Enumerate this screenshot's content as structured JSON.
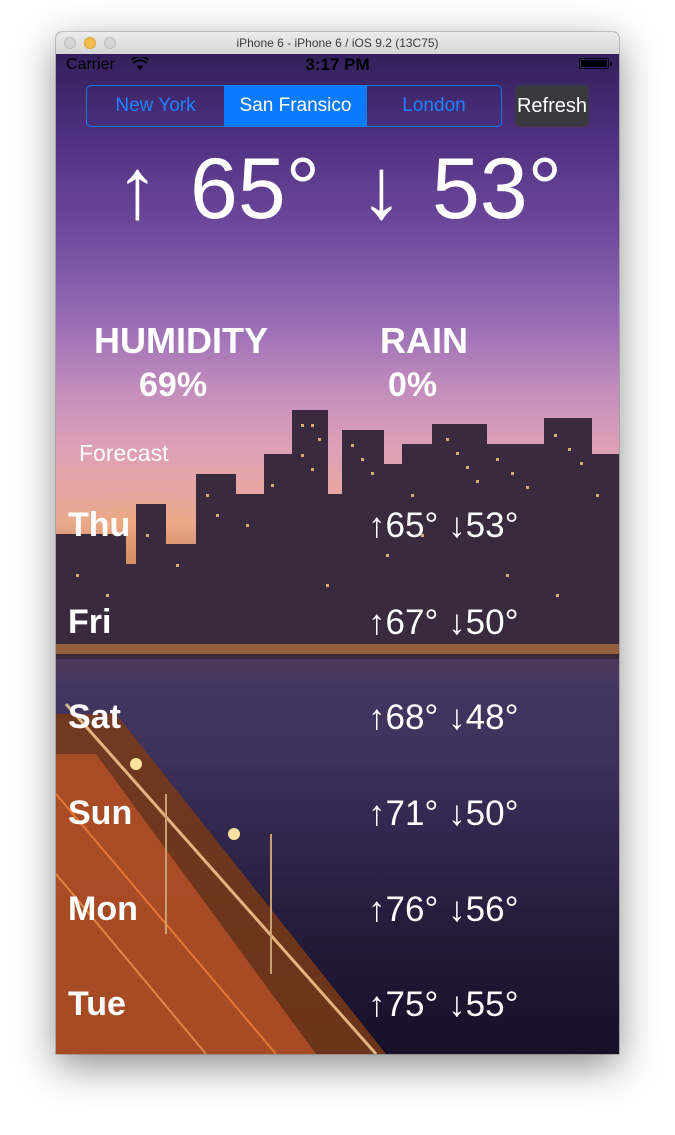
{
  "window": {
    "title": "iPhone 6 - iPhone 6 / iOS 9.2 (13C75)"
  },
  "status_bar": {
    "carrier": "Carrier",
    "time": "3:17 PM"
  },
  "city_selector": {
    "options": [
      "New York",
      "San Fransico",
      "London"
    ],
    "selected": "San Fransico"
  },
  "refresh_label": "Refresh",
  "current": {
    "up_arrow": "↑",
    "high": "65°",
    "down_arrow": "↓",
    "low": "53°"
  },
  "stats": {
    "humidity_label": "HUMIDITY",
    "humidity_value": "69%",
    "rain_label": "RAIN",
    "rain_value": "0%"
  },
  "forecast": {
    "header": "Forecast",
    "days": [
      {
        "day": "Thu",
        "hilo": "↑65° ↓53°"
      },
      {
        "day": "Fri",
        "hilo": "↑67° ↓50°"
      },
      {
        "day": "Sat",
        "hilo": "↑68° ↓48°"
      },
      {
        "day": "Sun",
        "hilo": "↑71° ↓50°"
      },
      {
        "day": "Mon",
        "hilo": "↑76° ↓56°"
      },
      {
        "day": "Tue",
        "hilo": "↑75° ↓55°"
      }
    ]
  },
  "colors": {
    "accent": "#0a7aff",
    "text": "#ffffff",
    "refresh_bg": "#3a3a3e"
  }
}
